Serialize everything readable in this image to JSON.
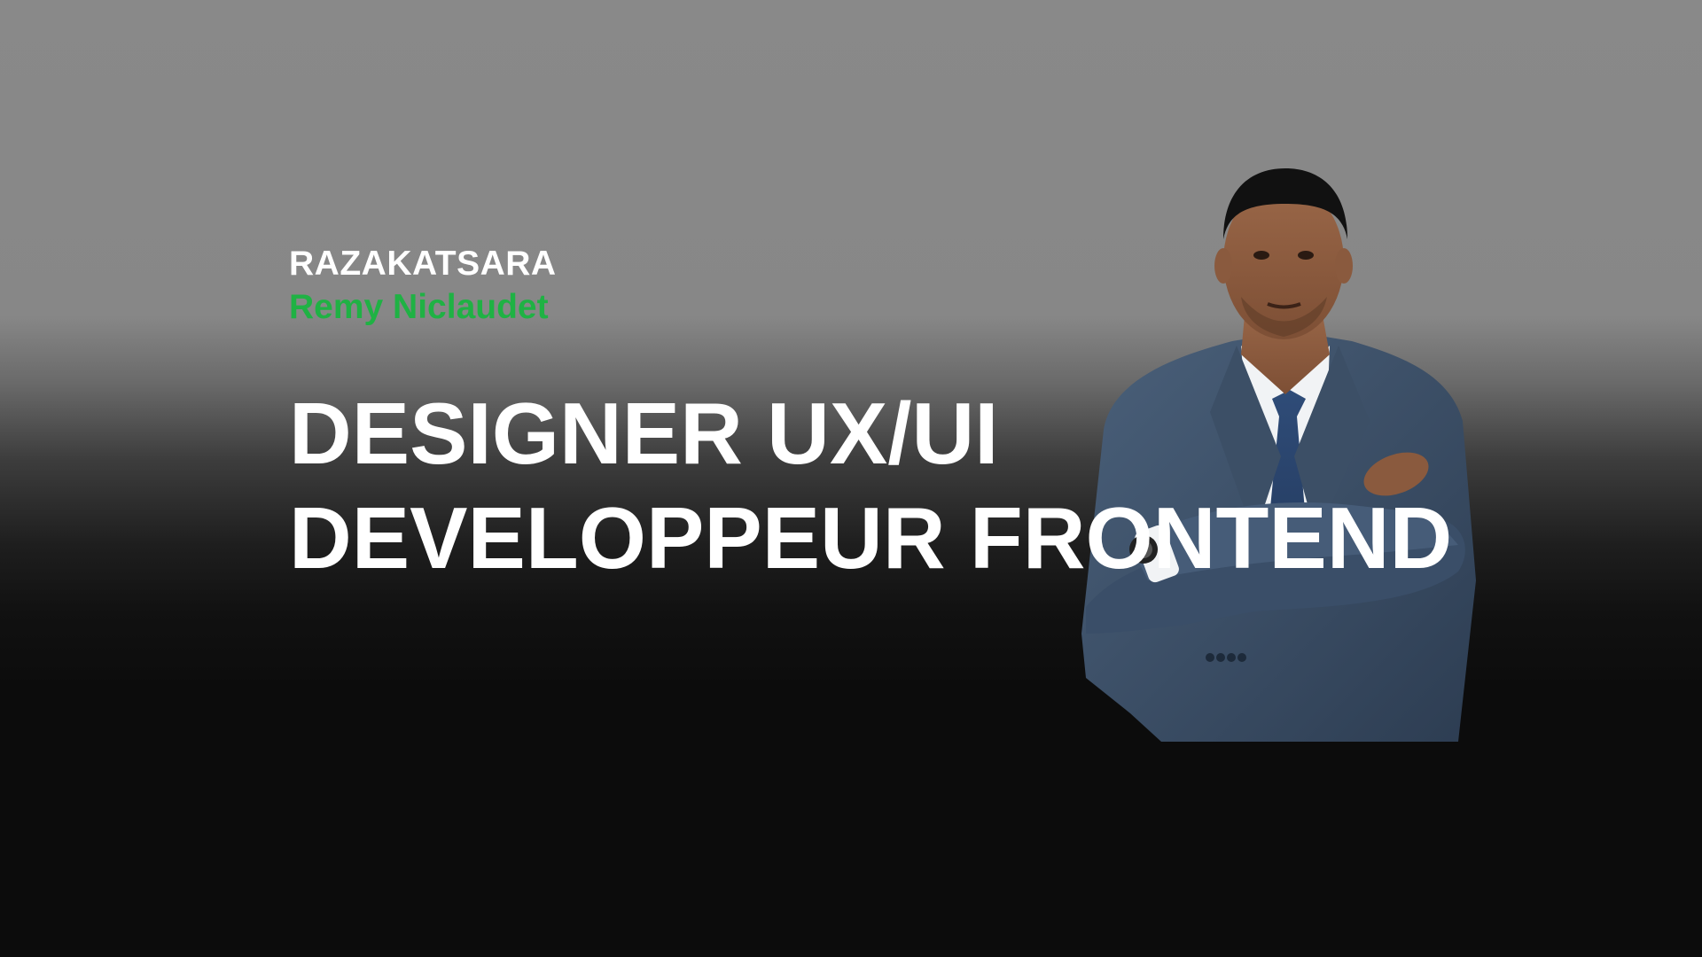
{
  "hero": {
    "last_name": "RAZAKATSARA",
    "first_name": "Remy Niclaudet",
    "headline_line1": "DESIGNER UX/UI",
    "headline_line2": "DEVELOPPEUR FRONTEND"
  },
  "colors": {
    "accent": "#1fb244",
    "text": "#ffffff",
    "background_top": "#898989",
    "background_bottom": "#0c0c0c"
  },
  "portrait": {
    "icon": "person-portrait"
  }
}
